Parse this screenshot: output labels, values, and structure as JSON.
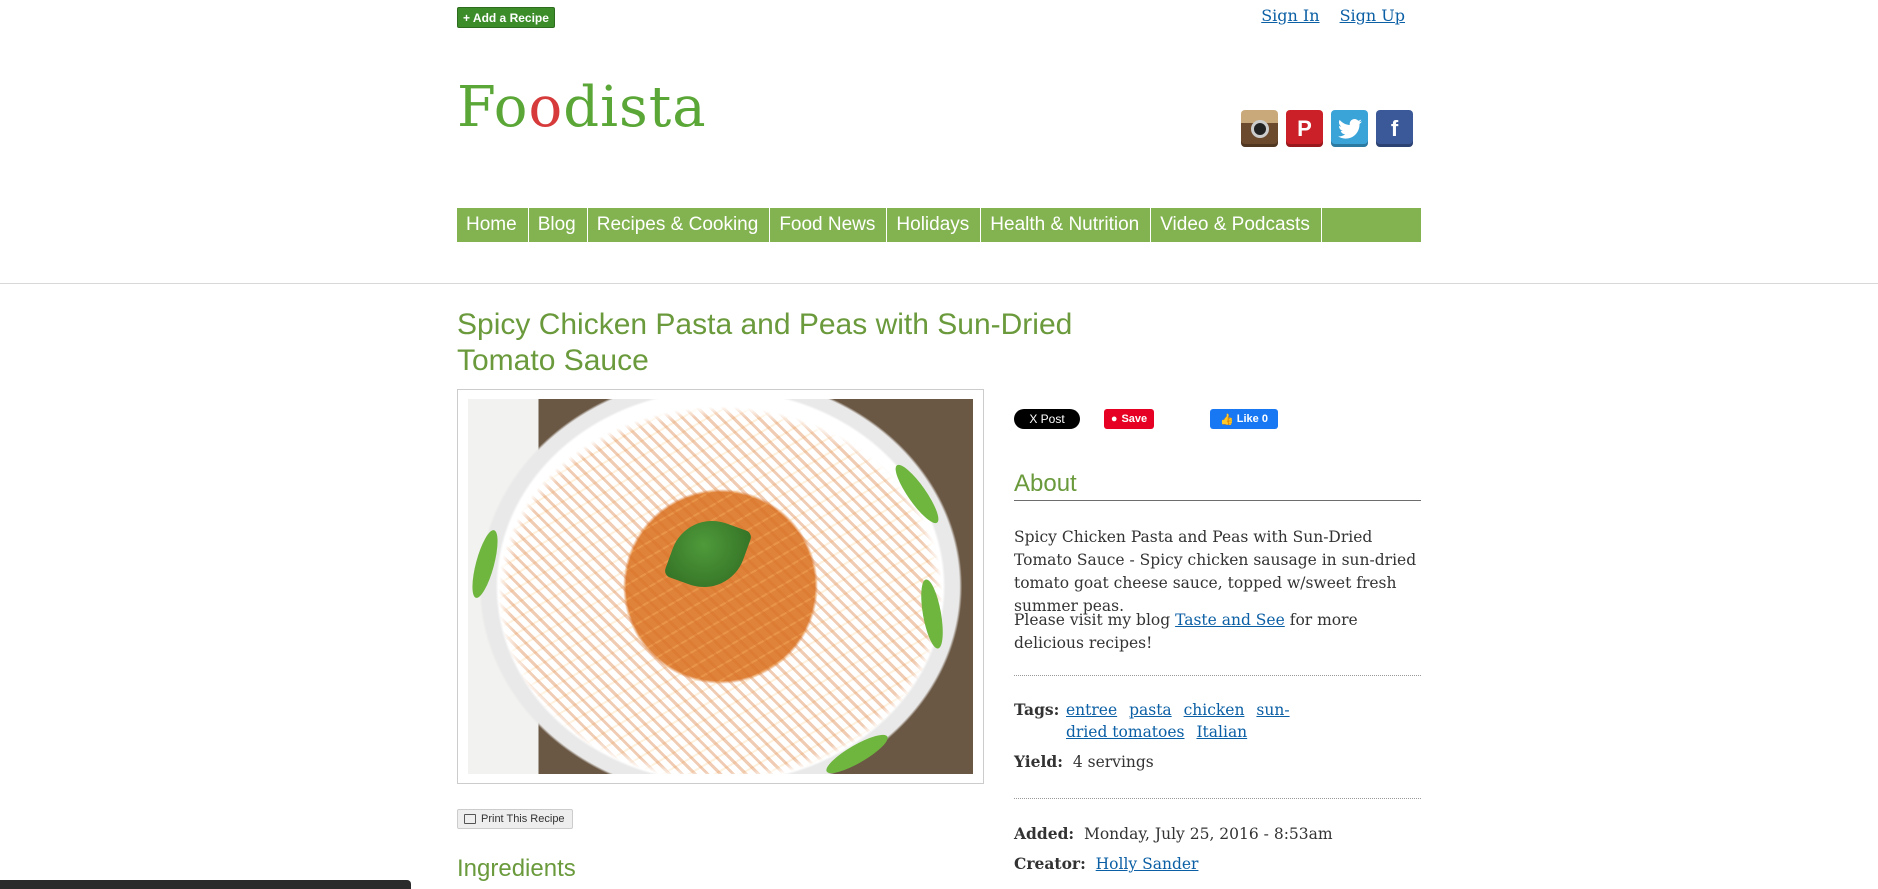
{
  "header": {
    "add_recipe_label": "+ Add a Recipe",
    "sign_in": "Sign In",
    "sign_up": "Sign Up",
    "logo_text_1": "Fo",
    "logo_text_2": "o",
    "logo_text_3": "dista"
  },
  "social": {
    "instagram": "instagram-icon",
    "pinterest": "pinterest-icon",
    "twitter": "twitter-icon",
    "facebook": "facebook-icon"
  },
  "nav": {
    "items": [
      "Home",
      "Blog",
      "Recipes & Cooking",
      "Food News",
      "Holidays",
      "Health & Nutrition",
      "Video & Podcasts"
    ]
  },
  "recipe": {
    "title": "Spicy Chicken Pasta and Peas with Sun-Dried Tomato Sauce",
    "print_label": "Print This Recipe",
    "ingredients_heading": "Ingredients"
  },
  "share": {
    "x_label": "X Post",
    "pin_label": "Save",
    "fb_label": "Like 0"
  },
  "about": {
    "heading": "About",
    "description": "Spicy Chicken Pasta and Peas with Sun-Dried Tomato Sauce - Spicy chicken sausage in sun-dried tomato goat cheese sauce, topped w/sweet fresh summer peas.",
    "blog_prefix": "Please visit my blog ",
    "blog_link": "Taste and See",
    "blog_suffix": " for more delicious recipes!"
  },
  "details": {
    "tags_label": "Tags:",
    "tags": [
      "entree",
      "pasta",
      "chicken",
      "sun-dried tomatoes",
      "Italian"
    ],
    "yield_label": "Yield:",
    "yield_value": "4 servings",
    "added_label": "Added:",
    "added_value": "Monday, July 25, 2016 - 8:53am",
    "creator_label": "Creator:",
    "creator_value": "Holly Sander"
  },
  "colors": {
    "brand_green": "#82b350",
    "title_green": "#6a9a3c",
    "link_blue": "#0b5fa5"
  }
}
